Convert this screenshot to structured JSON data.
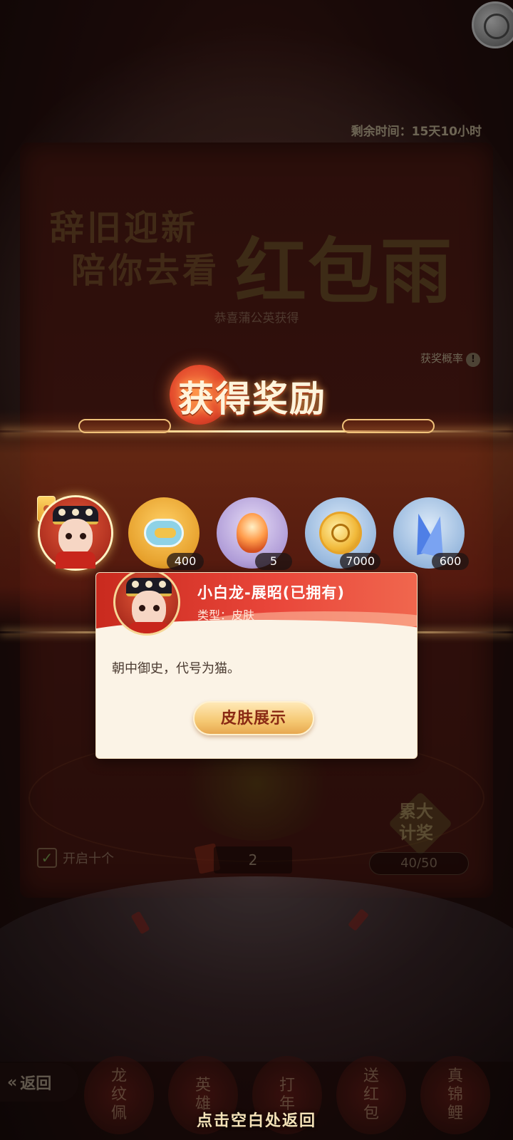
{
  "event": {
    "remaining_time": "剩余时间：15天10小时",
    "title_line1": "辞旧迎新",
    "title_line2": "陪你去看",
    "title_big": "红包雨",
    "congrats_line": "恭喜蒲公英获得",
    "probability_label": "获奖概率",
    "probability_icon": "!"
  },
  "controls": {
    "open_ten_label": "开启十个",
    "count_value": "2",
    "accum_label_top": "累大",
    "accum_label_bottom": "计奖",
    "accum_progress": "40/50",
    "accum_progress_fraction": 0.8
  },
  "reward_popup": {
    "title": "获得奖励",
    "items": [
      {
        "name": "skin-avatar",
        "count": "",
        "color": "#a8291b"
      },
      {
        "name": "gold-token",
        "count": "400",
        "color": "#e39a24"
      },
      {
        "name": "flame-crystal",
        "count": "5",
        "color": "#a893d3"
      },
      {
        "name": "gold-coin",
        "count": "7000",
        "color": "#8fb2da"
      },
      {
        "name": "blue-crystal",
        "count": "600",
        "color": "#8fb2da"
      }
    ],
    "detail": {
      "name": "小白龙-展昭(已拥有)",
      "type": "类型：皮肤",
      "description": "朝中御史，代号为猫。",
      "button": "皮肤展示"
    },
    "tap_hint": "点击空白处返回"
  },
  "nav": {
    "back": "返回",
    "items": [
      "龙纹佩",
      "英雄",
      "打年",
      "送红包",
      "真锦鲤"
    ]
  },
  "colors": {
    "accent_red": "#c92a1e",
    "accent_gold": "#f5c872",
    "card_bg": "#fbf3e6"
  }
}
